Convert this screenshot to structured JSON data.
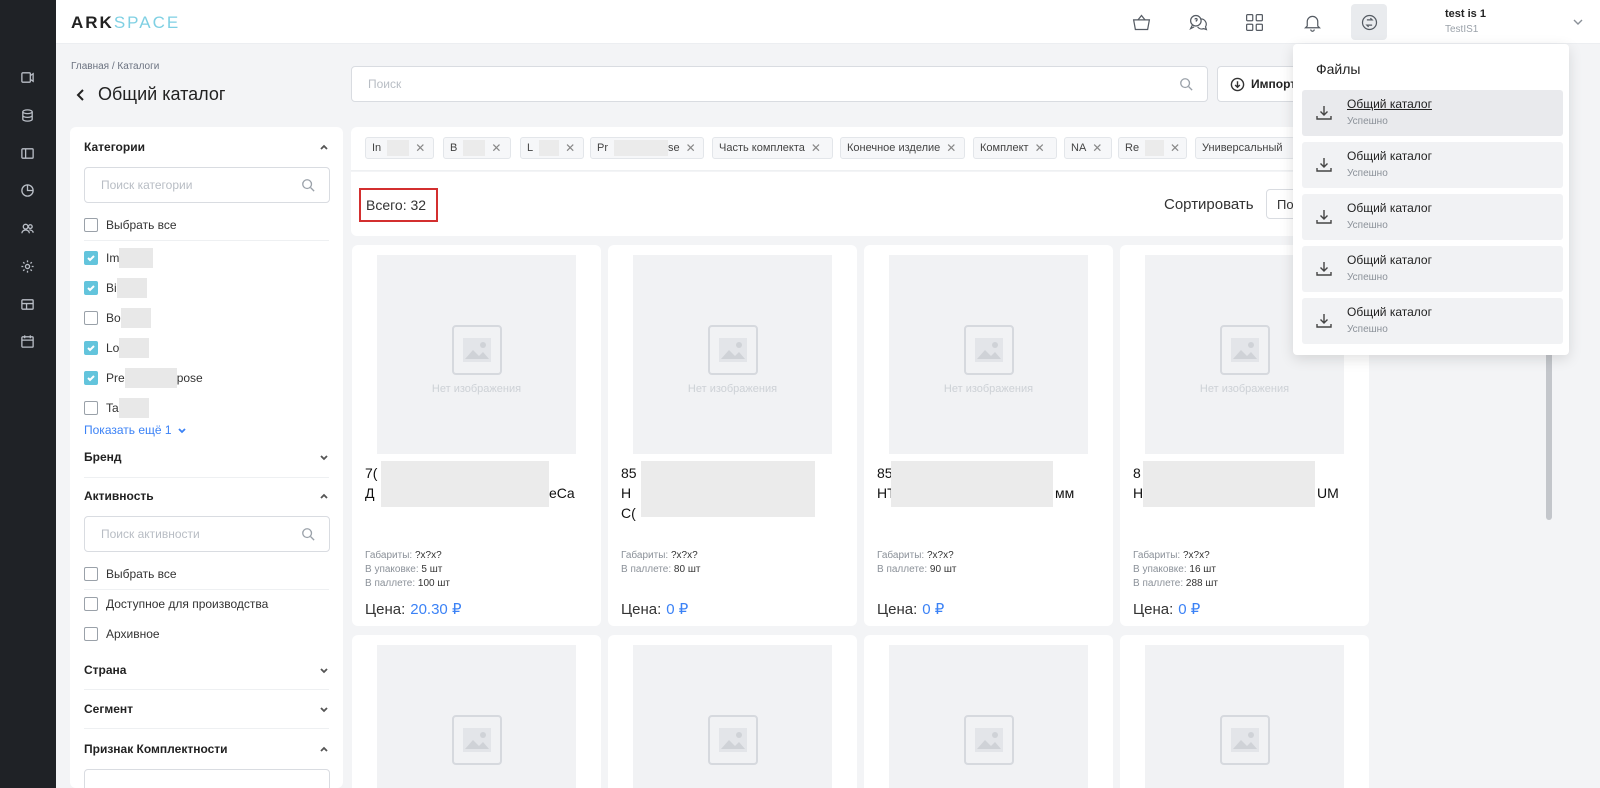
{
  "header": {
    "logo_a": "ARK",
    "logo_b": "SPACE",
    "user_name": "test is 1",
    "user_org": "TestIS1"
  },
  "breadcrumb": "Главная / Каталоги",
  "page_title": "Общий каталог",
  "search": {
    "placeholder": "Поиск"
  },
  "import_label": "Импорт",
  "filters": {
    "categories": {
      "title": "Категории",
      "search_placeholder": "Поиск категории",
      "select_all": "Выбрать все",
      "items": [
        {
          "label": "Im",
          "checked": true
        },
        {
          "label": "Bi",
          "checked": true
        },
        {
          "label": "Bo",
          "checked": false
        },
        {
          "label": "Lo",
          "checked": true
        },
        {
          "label": "Pre",
          "tail": "pose",
          "checked": true
        },
        {
          "label": "Ta",
          "checked": false
        }
      ],
      "show_more": "Показать ещё 1"
    },
    "brand": "Бренд",
    "activity": {
      "title": "Активность",
      "search_placeholder": "Поиск активности",
      "select_all": "Выбрать все",
      "items": [
        {
          "label": "Доступное для производства",
          "checked": false
        },
        {
          "label": "Архивное",
          "checked": false
        }
      ]
    },
    "country": "Страна",
    "segment": "Сегмент",
    "completeness": "Признак Комплектности"
  },
  "chips": [
    {
      "label": "In",
      "redacted": true
    },
    {
      "label": "B",
      "redacted": true
    },
    {
      "label": "L",
      "redacted": true
    },
    {
      "label": "Pr",
      "tail": "se",
      "redacted": true
    },
    {
      "label": "Часть комплекта"
    },
    {
      "label": "Конечное изделие"
    },
    {
      "label": "Комплект"
    },
    {
      "label": "NA"
    },
    {
      "label": "Re",
      "redacted": true
    },
    {
      "label": "Универсальный"
    }
  ],
  "total": "Всего: 32",
  "sort": {
    "label": "Сортировать",
    "value": "По"
  },
  "labels": {
    "no_image": "Нет изображения",
    "dims": "Габариты:",
    "pack": "В упаковке:",
    "pallet": "В паллете:",
    "price": "Цена:"
  },
  "products": [
    {
      "line1": "7(",
      "line2": "Д",
      "line2_tail": "eCa",
      "dims": "?x?x?",
      "pack": "5 шт",
      "pallet": "100 шт",
      "price": "20.30 ₽"
    },
    {
      "line1": "85",
      "line2": "Н",
      "line3": "С(",
      "dims": "?x?x?",
      "pallet": "80 шт",
      "price": "0 ₽"
    },
    {
      "line1": "85",
      "line2": "HT",
      "line2_tail": "мм",
      "dims": "?x?x?",
      "pallet": "90 шт",
      "price": "0 ₽"
    },
    {
      "line1": "8",
      "line2": "H",
      "line2_tail": "UM",
      "dims": "?x?x?",
      "pack": "16 шт",
      "pallet": "288 шт",
      "price": "0 ₽"
    }
  ],
  "files_panel": {
    "title": "Файлы",
    "items": [
      {
        "name": "Общий каталог",
        "status": "Успешно"
      },
      {
        "name": "Общий каталог",
        "status": "Успешно"
      },
      {
        "name": "Общий каталог",
        "status": "Успешно"
      },
      {
        "name": "Общий каталог",
        "status": "Успешно"
      },
      {
        "name": "Общий каталог",
        "status": "Успешно"
      }
    ]
  }
}
